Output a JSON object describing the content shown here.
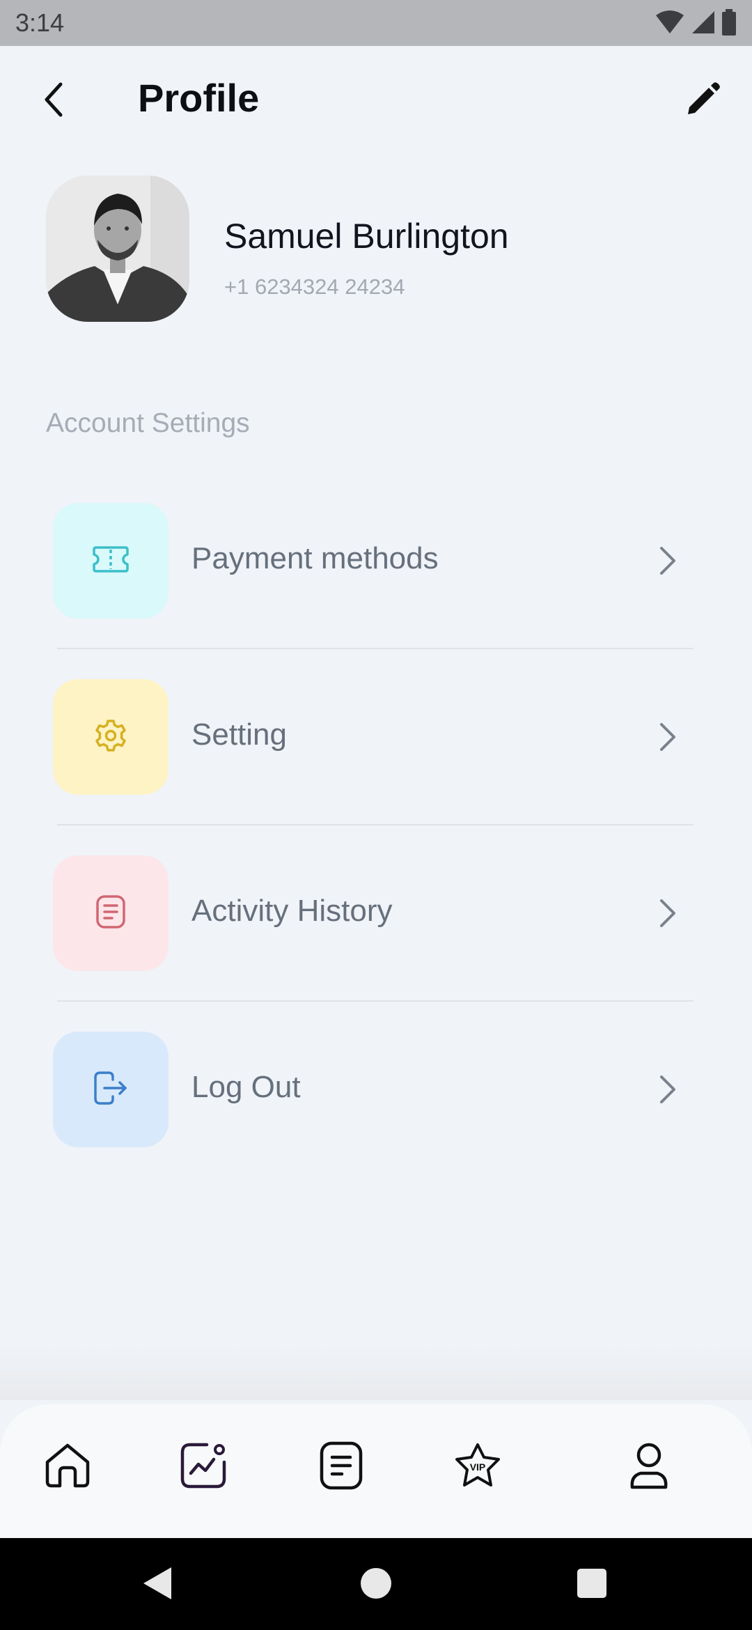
{
  "status_bar": {
    "time": "3:14",
    "icons": [
      "wifi-icon",
      "cellular-signal-icon",
      "battery-icon"
    ]
  },
  "header": {
    "title": "Profile",
    "back_icon": "chevron-left-icon",
    "edit_icon": "pencil-icon"
  },
  "profile": {
    "name": "Samuel Burlington",
    "phone": "+1 6234324 24234",
    "avatar_icon": "profile-photo"
  },
  "account_settings": {
    "section_label": "Account Settings",
    "items": [
      {
        "label": "Payment methods",
        "icon": "ticket-icon",
        "bg": "#d9f9fb",
        "color": "#3cbfc8"
      },
      {
        "label": "Setting",
        "icon": "gear-icon",
        "bg": "#fdf3c5",
        "color": "#d6b020"
      },
      {
        "label": "Activity History",
        "icon": "document-icon",
        "bg": "#fde6ea",
        "color": "#d06672"
      },
      {
        "label": "Log Out",
        "icon": "logout-icon",
        "bg": "#d8e9fb",
        "color": "#3b7fc8"
      }
    ]
  },
  "bottom_nav": {
    "items": [
      {
        "icon": "home-icon"
      },
      {
        "icon": "chart-icon"
      },
      {
        "icon": "document-icon"
      },
      {
        "icon": "vip-star-icon",
        "text": "VIP"
      },
      {
        "icon": "user-icon"
      }
    ]
  },
  "system_nav": {
    "items": [
      "back-triangle-icon",
      "home-circle-icon",
      "recents-square-icon"
    ]
  }
}
